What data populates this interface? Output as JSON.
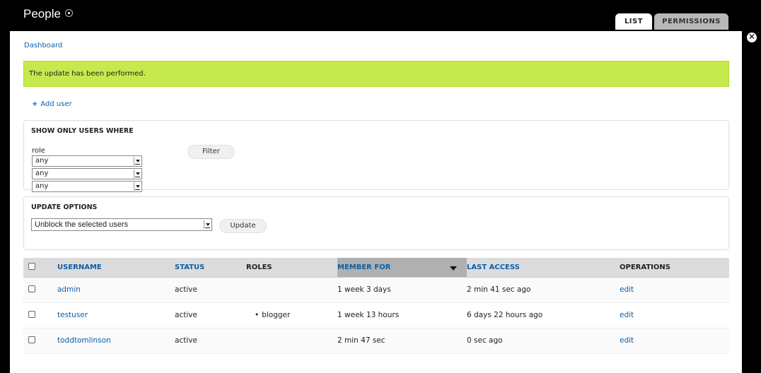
{
  "header": {
    "title": "People",
    "tabs": [
      {
        "label": "LIST",
        "active": true
      },
      {
        "label": "PERMISSIONS",
        "active": false
      }
    ]
  },
  "breadcrumb": "Dashboard",
  "message": "The update has been performed.",
  "action_link": {
    "icon": "+",
    "label": "Add user"
  },
  "filter": {
    "legend": "SHOW ONLY USERS WHERE",
    "role_label": "role",
    "selects": [
      "any",
      "any",
      "any"
    ],
    "button": "Filter"
  },
  "update_options": {
    "legend": "UPDATE OPTIONS",
    "selected": "Unblock the selected users",
    "button": "Update"
  },
  "table": {
    "columns": [
      "USERNAME",
      "STATUS",
      "ROLES",
      "MEMBER FOR",
      "LAST ACCESS",
      "OPERATIONS"
    ],
    "rows": [
      {
        "username": "admin",
        "status": "active",
        "roles": "",
        "member_for": "1 week 3 days",
        "last_access": "2 min 41 sec ago",
        "operation": "edit"
      },
      {
        "username": "testuser",
        "status": "active",
        "roles": "blogger",
        "member_for": "1 week 13 hours",
        "last_access": "6 days 22 hours ago",
        "operation": "edit"
      },
      {
        "username": "toddtomlinson",
        "status": "active",
        "roles": "",
        "member_for": "2 min 47 sec",
        "last_access": "0 sec ago",
        "operation": "edit"
      }
    ]
  },
  "colors": {
    "message_bg": "#c6ea4e",
    "link": "#0a5fa8",
    "header_bg": "#000000"
  }
}
